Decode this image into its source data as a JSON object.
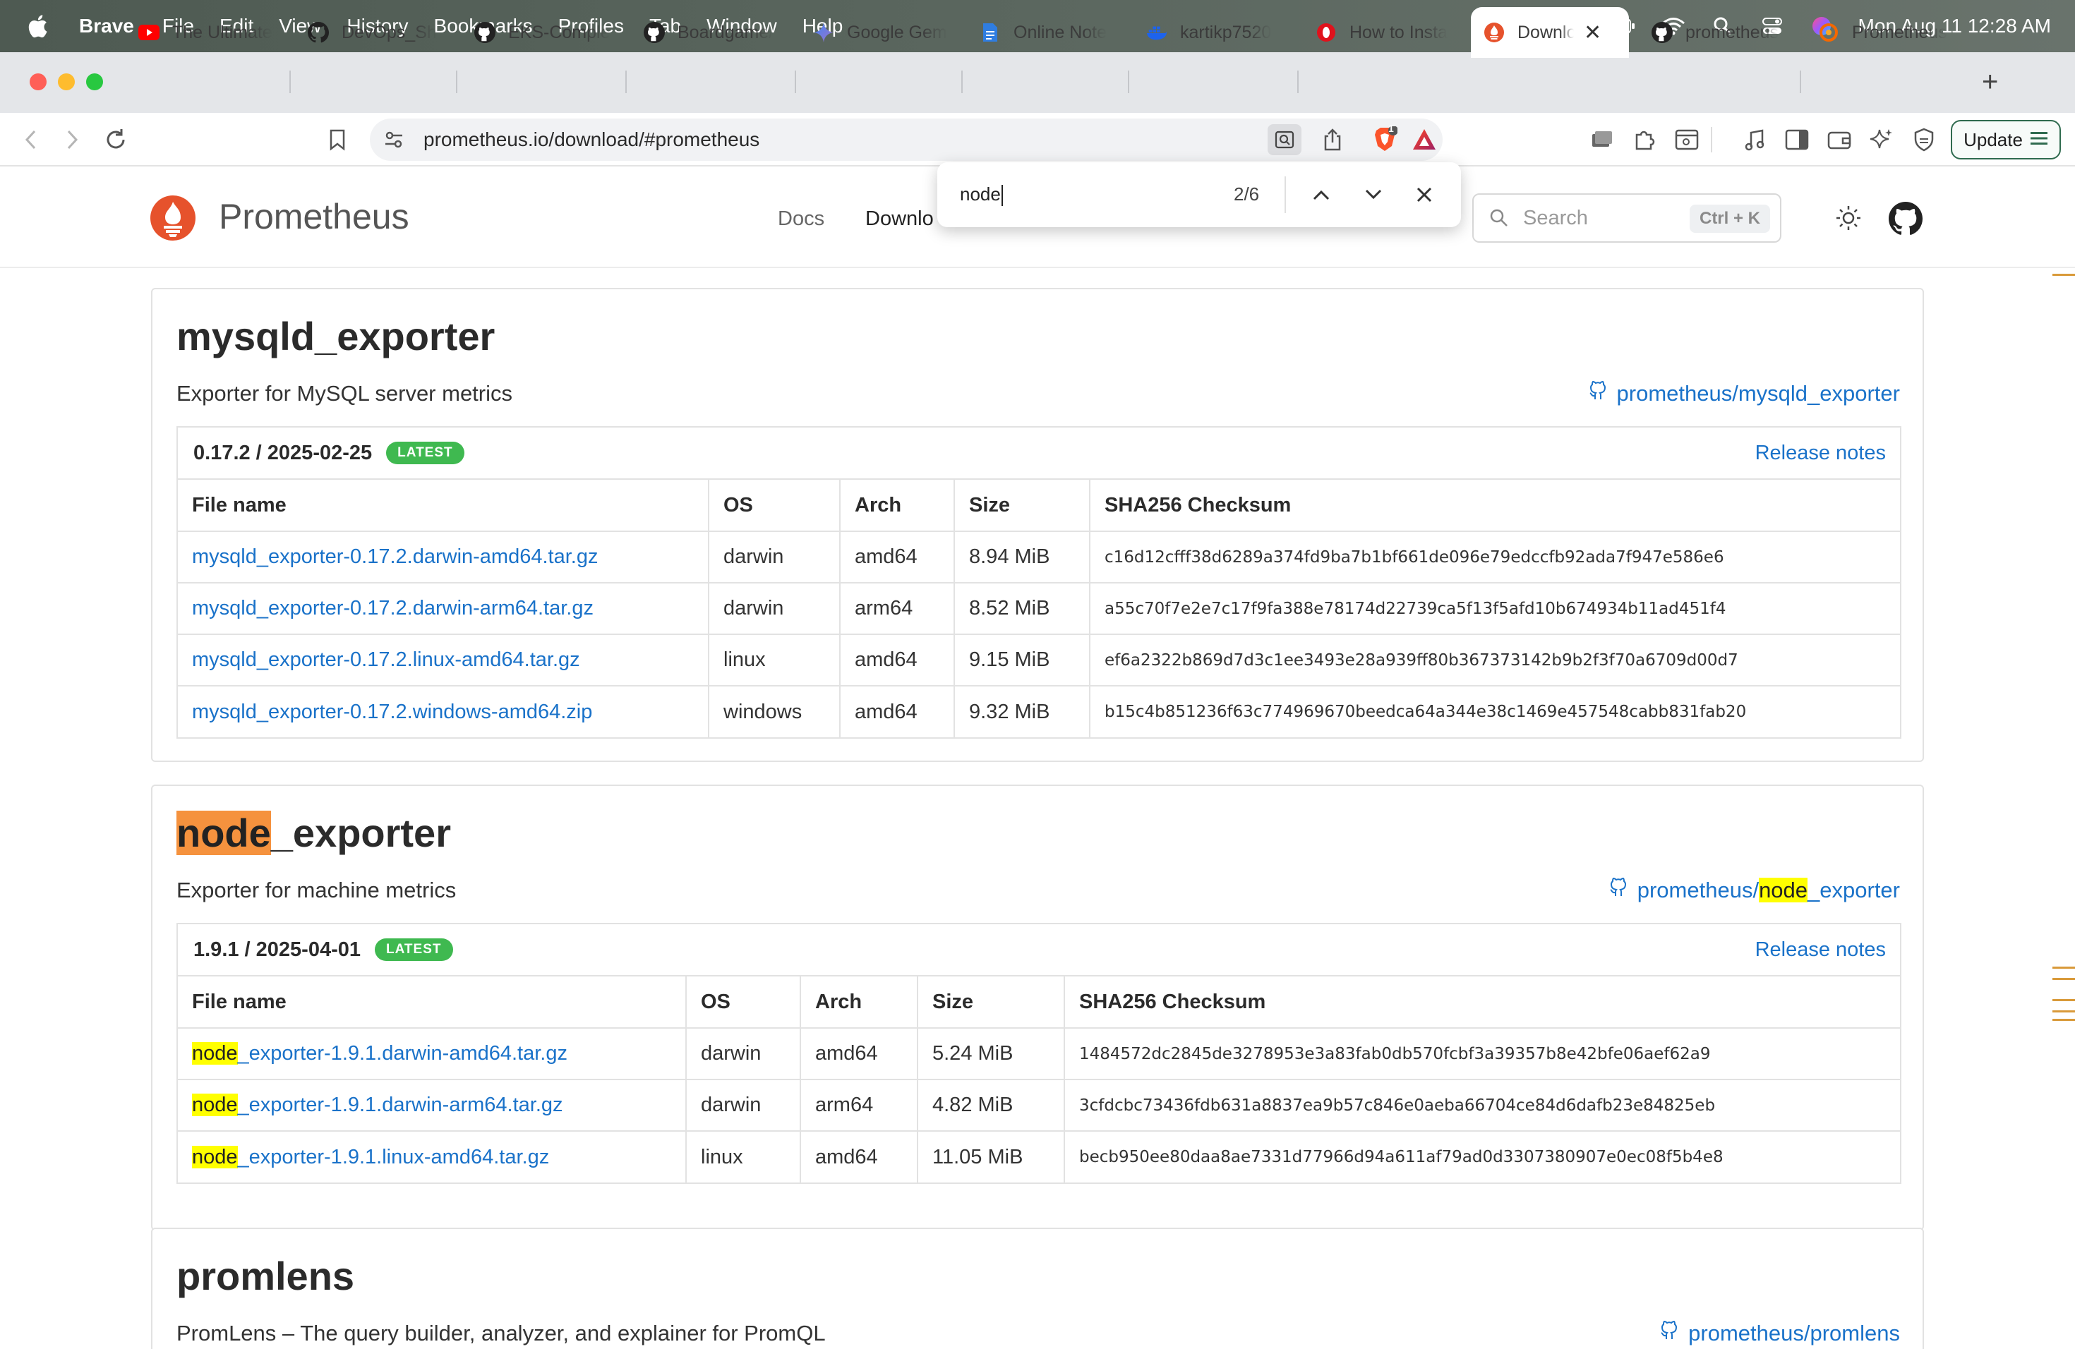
{
  "menubar": {
    "app": "Brave",
    "items": [
      "File",
      "Edit",
      "View",
      "History",
      "Bookmarks",
      "Profiles",
      "Tab",
      "Window",
      "Help"
    ],
    "clock": "Mon Aug 11  12:28 AM"
  },
  "tabs": [
    {
      "label": "The Ultimate",
      "icon": "youtube-icon"
    },
    {
      "label": "DevOps_Sh",
      "icon": "github-icon"
    },
    {
      "label": "EKS-Comple",
      "icon": "github-icon"
    },
    {
      "label": "Boardgame/",
      "icon": "github-icon"
    },
    {
      "label": "Google Gem",
      "icon": "gemini-icon"
    },
    {
      "label": "Online Note",
      "icon": "doc-icon"
    },
    {
      "label": "kartikp7520",
      "icon": "docker-icon"
    },
    {
      "label": "How to Insta",
      "icon": "opera-icon"
    },
    {
      "label": "Downlo",
      "icon": "prometheus-icon",
      "active": true
    },
    {
      "label": "prometheus",
      "icon": "github-icon"
    },
    {
      "label": "Prometheus",
      "icon": "grafana-icon"
    }
  ],
  "toolbar": {
    "url": "prometheus.io/download/#prometheus",
    "brave_badge": "1",
    "update_label": "Update"
  },
  "site": {
    "title": "Prometheus",
    "nav": [
      "Docs",
      "Downlo"
    ],
    "search_placeholder": "Search",
    "search_shortcut": "Ctrl + K"
  },
  "find": {
    "query": "node",
    "count": "2/6"
  },
  "sections": {
    "mysqld": {
      "title": "mysqld_exporter",
      "description": "Exporter for MySQL server metrics",
      "repo": "prometheus/mysqld_exporter",
      "version": "0.17.2 / 2025-02-25",
      "badge": "LATEST",
      "release_notes": "Release notes",
      "headers": [
        "File name",
        "OS",
        "Arch",
        "Size",
        "SHA256 Checksum"
      ],
      "rows": [
        [
          "mysqld_exporter-0.17.2.darwin-amd64.tar.gz",
          "darwin",
          "amd64",
          "8.94 MiB",
          "c16d12cfff38d6289a374fd9ba7b1bf661de096e79edccfb92ada7f947e586e6"
        ],
        [
          "mysqld_exporter-0.17.2.darwin-arm64.tar.gz",
          "darwin",
          "arm64",
          "8.52 MiB",
          "a55c70f7e2e7c17f9fa388e78174d22739ca5f13f5afd10b674934b11ad451f4"
        ],
        [
          "mysqld_exporter-0.17.2.linux-amd64.tar.gz",
          "linux",
          "amd64",
          "9.15 MiB",
          "ef6a2322b869d7d3c1ee3493e28a939ff80b367373142b9b2f3f70a6709d00d7"
        ],
        [
          "mysqld_exporter-0.17.2.windows-amd64.zip",
          "windows",
          "amd64",
          "9.32 MiB",
          "b15c4b851236f63c774969670beedca64a344e38c1469e457548cabb831fab20"
        ]
      ]
    },
    "node": {
      "title_hl": "node",
      "title_rest": "_exporter",
      "description": "Exporter for machine metrics",
      "repo_prefix": "prometheus/",
      "repo_hl": "node",
      "repo_rest": "_exporter",
      "version": "1.9.1 / 2025-04-01",
      "badge": "LATEST",
      "release_notes": "Release notes",
      "headers": [
        "File name",
        "OS",
        "Arch",
        "Size",
        "SHA256 Checksum"
      ],
      "rows": [
        [
          "node",
          "_exporter-1.9.1.darwin-amd64.tar.gz",
          "darwin",
          "amd64",
          "5.24 MiB",
          "1484572dc2845de3278953e3a83fab0db570fcbf3a39357b8e42bfe06aef62a9"
        ],
        [
          "node",
          "_exporter-1.9.1.darwin-arm64.tar.gz",
          "darwin",
          "arm64",
          "4.82 MiB",
          "3cfdcbc73436fdb631a8837ea9b57c846e0aeba66704ce84d6dafb23e84825eb"
        ],
        [
          "node",
          "_exporter-1.9.1.linux-amd64.tar.gz",
          "linux",
          "amd64",
          "11.05 MiB",
          "becb950ee80daa8ae7331d77966d94a611af79ad0d3307380907e0ec08f5b4e8"
        ]
      ]
    },
    "promlens": {
      "title": "promlens",
      "description": "PromLens – The query builder, analyzer, and explainer for PromQL",
      "repo": "prometheus/promlens"
    }
  }
}
